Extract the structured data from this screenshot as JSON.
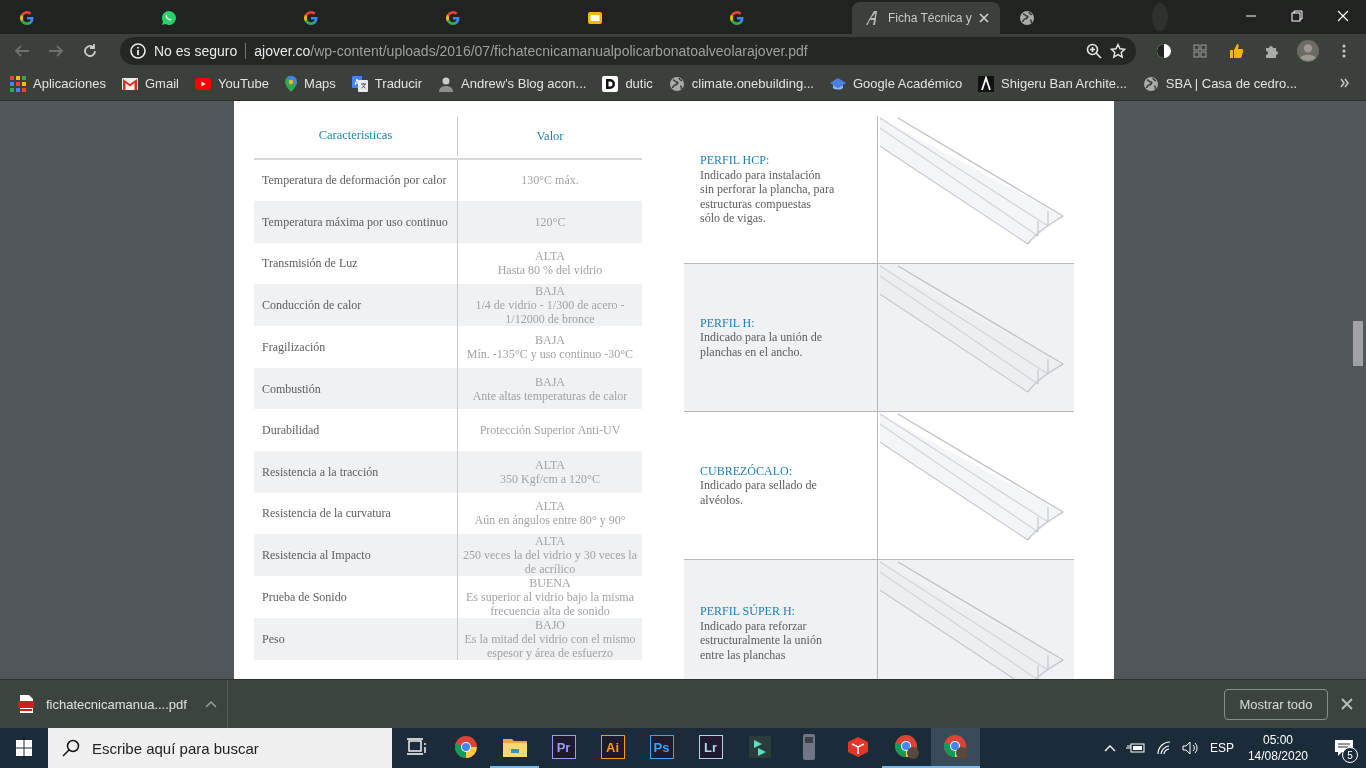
{
  "browser": {
    "tabs": [
      {
        "kind": "google",
        "selected": false
      },
      {
        "kind": "whatsapp",
        "selected": false
      },
      {
        "kind": "google",
        "selected": false
      },
      {
        "kind": "google",
        "selected": false
      },
      {
        "kind": "slides",
        "selected": false
      },
      {
        "kind": "google",
        "selected": false
      },
      {
        "kind": "pdf-logo",
        "title": "Ficha Técnica y",
        "selected": true
      },
      {
        "kind": "globe",
        "selected": false
      }
    ],
    "address": {
      "security": "No es seguro",
      "host": "ajover.co",
      "path": "/wp-content/uploads/2016/07/fichatecnicamanualpolicarbonatoalveolarajover.pdf"
    },
    "bookmarks": [
      {
        "kind": "apps",
        "label": "Aplicaciones"
      },
      {
        "kind": "gmail",
        "label": "Gmail"
      },
      {
        "kind": "youtube",
        "label": "YouTube"
      },
      {
        "kind": "maps",
        "label": "Maps"
      },
      {
        "kind": "translate",
        "label": "Traducir"
      },
      {
        "kind": "person",
        "label": "Andrew's Blog acon..."
      },
      {
        "kind": "d-logo",
        "label": "dutic"
      },
      {
        "kind": "globe",
        "label": "climate.onebuilding..."
      },
      {
        "kind": "cap",
        "label": "Google Académico"
      },
      {
        "kind": "lambda",
        "label": "Shigeru Ban Archite..."
      },
      {
        "kind": "globe",
        "label": "SBA | Casa de cedro..."
      }
    ]
  },
  "pdf": {
    "table": {
      "columns": [
        "Caracteristicas",
        "Valor"
      ],
      "rows": [
        {
          "feature": "Temperatura de deformación por calor",
          "value": [
            "130°C máx."
          ]
        },
        {
          "feature": "Temperatura máxima por uso continuo",
          "value": [
            "120°C"
          ]
        },
        {
          "feature": "Transmisión de Luz",
          "value": [
            "ALTA",
            "Hasta 80 % del vidrio"
          ]
        },
        {
          "feature": "Conducción de calor",
          "value": [
            "BAJA",
            "1/4 de vidrio - 1/300 de acero - 1/12000 de bronce"
          ]
        },
        {
          "feature": "Fragilización",
          "value": [
            "BAJA",
            "Mín. -135°C y uso continuo -30°C"
          ]
        },
        {
          "feature": "Combustión",
          "value": [
            "BAJA",
            "Ante altas temperaturas de calor"
          ]
        },
        {
          "feature": "Durabilidad",
          "value": [
            "Protección Superior Anti-UV"
          ]
        },
        {
          "feature": "Resistencia a la tracción",
          "value": [
            "ALTA",
            "350 Kgf/cm  a 120°C"
          ]
        },
        {
          "feature": "Resistencia de la curvatura",
          "value": [
            "ALTA",
            "Aún en ángulos entre 80° y 90°"
          ]
        },
        {
          "feature": "Resistencia al Impacto",
          "value": [
            "ALTA",
            "250 veces la del vidrio y 30 veces la de acrílico"
          ]
        },
        {
          "feature": "Prueba de Sonido",
          "value": [
            "BUENA",
            "Es superior al vidrio bajo la misma frecuencia alta de sonido"
          ]
        },
        {
          "feature": "Peso",
          "value": [
            "BAJO",
            "Es la mitad del vidrio con el mismo espesor y área de esfuerzo"
          ]
        }
      ]
    },
    "accessories": [
      {
        "title": "PERFIL HCP:",
        "description": [
          "Indicado para instalación",
          "sin perforar la plancha, para",
          "estructuras compuestas",
          "sólo de vigas."
        ]
      },
      {
        "title": "PERFIL H:",
        "description": [
          "Indicado para la unión de",
          "planchas en el ancho."
        ]
      },
      {
        "title": "CUBREZÓCALO:",
        "description": [
          "Indicado para sellado de alvéolos."
        ]
      },
      {
        "title": "PERFIL SÚPER H:",
        "description": [
          "Indicado para reforzar",
          "estructuralmente la unión",
          "entre las planchas"
        ]
      }
    ]
  },
  "downloads": {
    "file": "fichatecnicamanua....pdf",
    "show_all": "Mostrar todo"
  },
  "taskbar": {
    "search_placeholder": "Escribe aquí para buscar",
    "apps": [
      {
        "kind": "taskview",
        "running": false,
        "selected": false
      },
      {
        "kind": "chrome",
        "running": false,
        "selected": false
      },
      {
        "kind": "folder",
        "running": true,
        "selected": false
      },
      {
        "kind": "badge",
        "label": "Pr",
        "color": "#9999ff",
        "running": false,
        "selected": false
      },
      {
        "kind": "badge",
        "label": "Ai",
        "color": "#ff9a00",
        "running": false,
        "selected": false
      },
      {
        "kind": "badge",
        "label": "Ps",
        "color": "#31a8ff",
        "running": false,
        "selected": false
      },
      {
        "kind": "badge",
        "label": "Lr",
        "color": "#add5ec",
        "running": false,
        "selected": false
      },
      {
        "kind": "filmora",
        "running": false,
        "selected": false
      },
      {
        "kind": "device",
        "running": false,
        "selected": false
      },
      {
        "kind": "sketchup",
        "running": false,
        "selected": false
      },
      {
        "kind": "chrome-profile",
        "running": true,
        "selected": false
      },
      {
        "kind": "chrome-profile",
        "running": true,
        "selected": true
      }
    ],
    "tray": {
      "language": "ESP",
      "time": "05:00",
      "date": "14/08/2020",
      "notifications": "5"
    }
  }
}
